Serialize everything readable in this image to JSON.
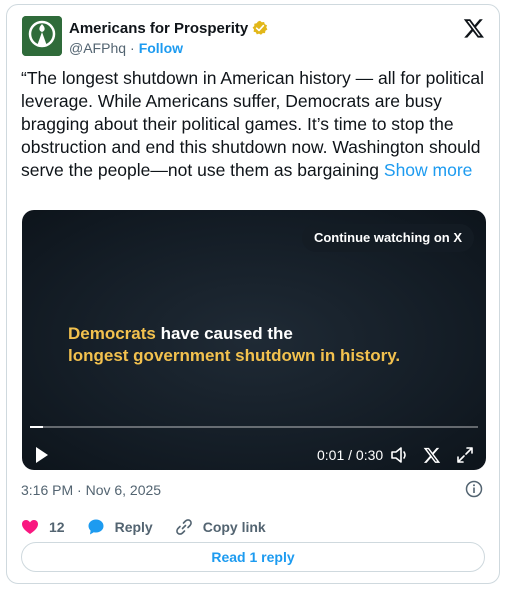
{
  "colors": {
    "accent": "#1d9bf0",
    "like": "#f91880",
    "verified_badge": "#e2b719",
    "headline_highlight": "#f2c14e"
  },
  "account": {
    "name": "Americans for Prosperity",
    "handle": "@AFPhq",
    "separator": "·",
    "follow_label": "Follow",
    "avatar_icon": "torch-logo-icon",
    "badge_icon": "verified-gold-badge-icon"
  },
  "platform_icon": "x-logo-icon",
  "tweet": {
    "text": "“The longest shutdown in American history — all for political leverage. While Americans suffer, Democrats are busy bragging about their political games. It’s time to stop the obstruction and end this shutdown now. Washington should serve the people—not use them as bargaining",
    "show_more": "Show more"
  },
  "video": {
    "continue_label": "Continue watching on X",
    "headline_highlight": "Democrats",
    "headline_rest_line1": " have caused the",
    "headline_line2": "longest government shutdown in history.",
    "time": "0:01 / 0:30",
    "progress_fraction": 0.03,
    "icons": [
      "play-icon",
      "volume-icon",
      "x-logo-icon",
      "fullscreen-icon"
    ]
  },
  "timestamp": "3:16 PM · Nov 6, 2025",
  "actions": {
    "like_count": "12",
    "reply_label": "Reply",
    "copy_link_label": "Copy link"
  },
  "read_replies_label": "Read 1 reply"
}
